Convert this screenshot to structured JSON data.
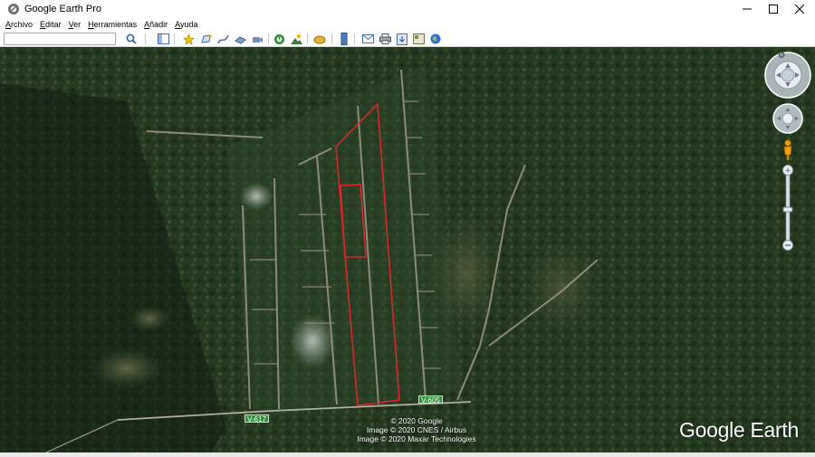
{
  "window": {
    "title": "Google Earth Pro",
    "controls": {
      "minimize": "minimize",
      "maximize": "maximize",
      "close": "close"
    }
  },
  "menu": [
    {
      "access": "A",
      "rest": "rchivo"
    },
    {
      "access": "E",
      "rest": "ditar"
    },
    {
      "access": "V",
      "rest": "er"
    },
    {
      "access": "H",
      "rest": "erramientas"
    },
    {
      "access": "A",
      "rest": "ñadir"
    },
    {
      "access": "A",
      "rest": "yuda"
    }
  ],
  "search": {
    "value": "",
    "placeholder": ""
  },
  "toolbar_icons": [
    "search-icon",
    "sidebar-icon",
    "placemark-icon",
    "polygon-icon",
    "path-icon",
    "image-overlay-icon",
    "record-tour-icon",
    "historical-imagery-icon",
    "sunlight-icon",
    "planets-icon",
    "ruler-icon",
    "email-icon",
    "print-icon",
    "save-image-icon",
    "view-in-maps-icon",
    "earth-icon"
  ],
  "map": {
    "road_labels": [
      "V-617",
      "V-605"
    ],
    "credits": [
      "© 2020 Google",
      "Image © 2020 CNES / Airbus",
      "Image © 2020 Maxar Technologies"
    ],
    "logo": "Google Earth",
    "compass_north": "N",
    "overlay_color": "#e0242a"
  },
  "colors": {
    "forest": "#20321f",
    "road_label": "#2f8f3a"
  }
}
